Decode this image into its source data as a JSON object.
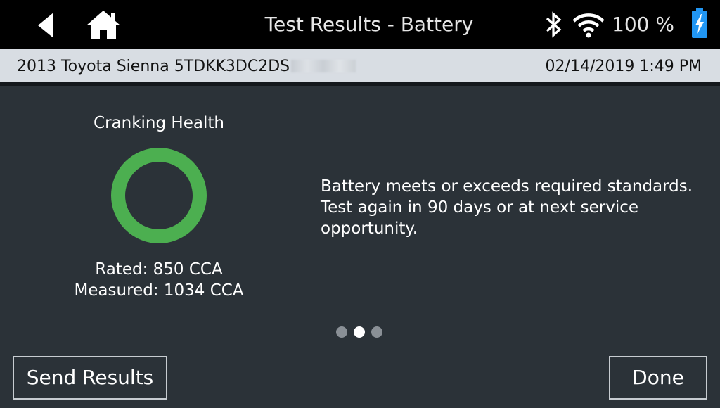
{
  "header": {
    "title": "Test Results - Battery",
    "battery_percent": "100 %"
  },
  "vehicle_bar": {
    "vehicle": "2013 Toyota Sienna  5TDKK3DC2DS",
    "datetime": "02/14/2019 1:49 PM"
  },
  "result": {
    "gauge_label": "Cranking Health",
    "gauge_color": "#4caf50",
    "rated": "Rated:  850 CCA",
    "measured": "Measured:  1034 CCA",
    "message": "Battery meets or exceeds required standards. Test again in 90 days or at next service opportunity."
  },
  "pager": {
    "current_page": 2,
    "total_pages": 3
  },
  "footer": {
    "send_label": "Send Results",
    "done_label": "Done"
  },
  "colors": {
    "background": "#2b3238",
    "topbar": "#000000",
    "infobar": "#d8dde3",
    "accent_battery": "#2196f3"
  }
}
